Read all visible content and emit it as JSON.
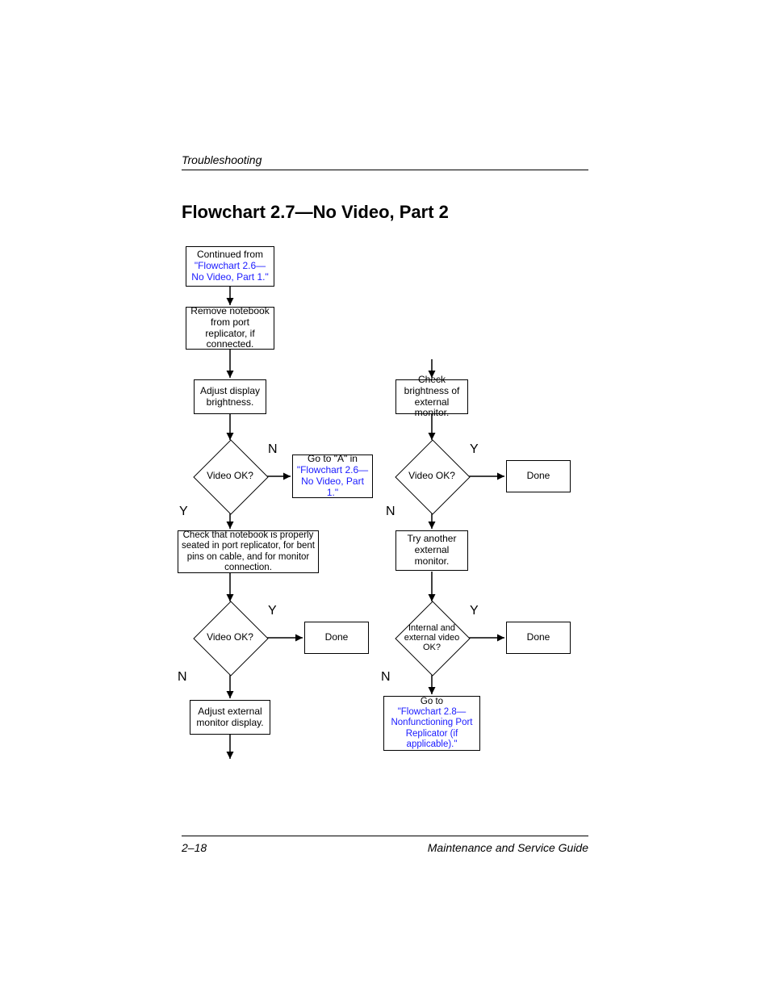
{
  "header": {
    "section": "Troubleshooting"
  },
  "title": "Flowchart 2.7—No Video, Part 2",
  "nodes": {
    "start": {
      "text1": "Continued from",
      "link": "\"Flowchart 2.6—No Video, Part 1.\""
    },
    "remove": "Remove notebook from port replicator, if connected.",
    "adjust": "Adjust display brightness.",
    "checkExt": "Check brightness of external monitor.",
    "video1": "Video OK?",
    "video2": "Video OK?",
    "gotoA": {
      "text1": "Go to \"A\" in",
      "link": "\"Flowchart 2.6—No Video, Part 1.\""
    },
    "done1": "Done",
    "checkSeated": "Check that notebook is properly seated in port replicator, for bent pins on cable, and for monitor connection.",
    "tryAnother": "Try another external monitor.",
    "video3": "Video OK?",
    "intExt": "Internal and external video OK?",
    "done2": "Done",
    "done3": "Done",
    "adjustExt": "Adjust external monitor display.",
    "goto28": {
      "text1": "Go to",
      "link": "\"Flowchart 2.8—Nonfunctioning Port Replicator (if applicable).\""
    }
  },
  "labels": {
    "Y": "Y",
    "N": "N"
  },
  "footer": {
    "page": "2–18",
    "book": "Maintenance and Service Guide"
  }
}
